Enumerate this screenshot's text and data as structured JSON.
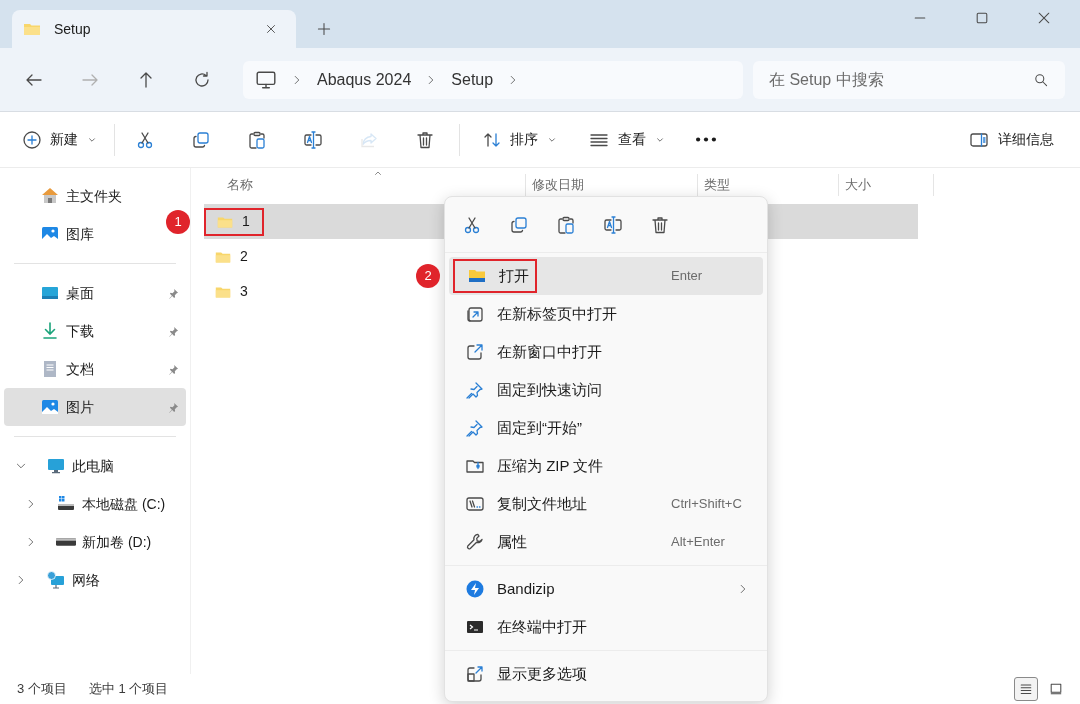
{
  "window": {
    "tab_title": "Setup"
  },
  "nav": {
    "forward_disabled": true,
    "breadcrumb": [
      "Abaqus 2024",
      "Setup"
    ],
    "search": {
      "placeholder": "在 Setup 中搜索"
    }
  },
  "toolbar": {
    "new": "新建",
    "icons": [
      {
        "kind": "cut",
        "disabled": false
      },
      {
        "kind": "copy",
        "disabled": false
      },
      {
        "kind": "paste",
        "disabled": false
      },
      {
        "kind": "rename",
        "disabled": false
      },
      {
        "kind": "share",
        "disabled": true
      },
      {
        "kind": "delete",
        "disabled": false
      }
    ],
    "sort": "排序",
    "view": "查看",
    "details": "详细信息"
  },
  "sidebar": {
    "quick": [
      {
        "kind": "home",
        "label": "主文件夹",
        "selected": false
      },
      {
        "kind": "gallery",
        "label": "图库",
        "selected": false
      }
    ],
    "pinned": [
      {
        "kind": "desktop",
        "label": "桌面",
        "selected": false
      },
      {
        "kind": "download",
        "label": "下载",
        "selected": false
      },
      {
        "kind": "document",
        "label": "文档",
        "selected": false
      },
      {
        "kind": "picture",
        "label": "图片",
        "selected": true
      }
    ],
    "tree": [
      {
        "kind": "pc",
        "label": "此电脑",
        "expanded": true,
        "selected": false,
        "children": [
          {
            "kind": "drive-c",
            "label": "本地磁盘 (C:)",
            "expanded": false,
            "selected": false
          },
          {
            "kind": "drive",
            "label": "新加卷 (D:)",
            "expanded": false,
            "selected": false
          }
        ]
      },
      {
        "kind": "network",
        "label": "网络",
        "expanded": false,
        "selected": false
      }
    ]
  },
  "files": {
    "columns": [
      "名称",
      "修改日期",
      "类型",
      "大小"
    ],
    "rows": [
      {
        "name": "1",
        "selected": true,
        "marker": "1"
      },
      {
        "name": "2",
        "selected": false
      },
      {
        "name": "3",
        "selected": false
      }
    ]
  },
  "context_menu": {
    "actions": [
      {
        "kind": "cut"
      },
      {
        "kind": "copy"
      },
      {
        "kind": "paste"
      },
      {
        "kind": "rename"
      },
      {
        "kind": "delete"
      }
    ],
    "sections": [
      [
        {
          "kind": "open",
          "label": "打开",
          "shortcut": "Enter",
          "highlighted": true,
          "marker": "2"
        },
        {
          "kind": "open-tab",
          "label": "在新标签页中打开",
          "highlighted": false
        },
        {
          "kind": "open-window",
          "label": "在新窗口中打开",
          "highlighted": false
        },
        {
          "kind": "pin",
          "label": "固定到快速访问",
          "highlighted": false
        },
        {
          "kind": "pin",
          "label": "固定到“开始”",
          "highlighted": false
        },
        {
          "kind": "zip",
          "label": "压缩为 ZIP 文件",
          "highlighted": false
        },
        {
          "kind": "path",
          "label": "复制文件地址",
          "shortcut": "Ctrl+Shift+C",
          "highlighted": false
        },
        {
          "kind": "properties",
          "label": "属性",
          "shortcut": "Alt+Enter",
          "highlighted": false
        }
      ],
      [
        {
          "kind": "bandizip",
          "label": "Bandizip",
          "submenu": true,
          "highlighted": false
        },
        {
          "kind": "terminal",
          "label": "在终端中打开",
          "highlighted": false
        }
      ],
      [
        {
          "kind": "more",
          "label": "显示更多选项",
          "highlighted": false
        }
      ]
    ]
  },
  "status_bar": {
    "texts": [
      "3 个项目",
      "选中 1 个项目"
    ],
    "views": [
      {
        "kind": "details",
        "selected": true
      },
      {
        "kind": "tiles",
        "selected": false
      }
    ]
  }
}
